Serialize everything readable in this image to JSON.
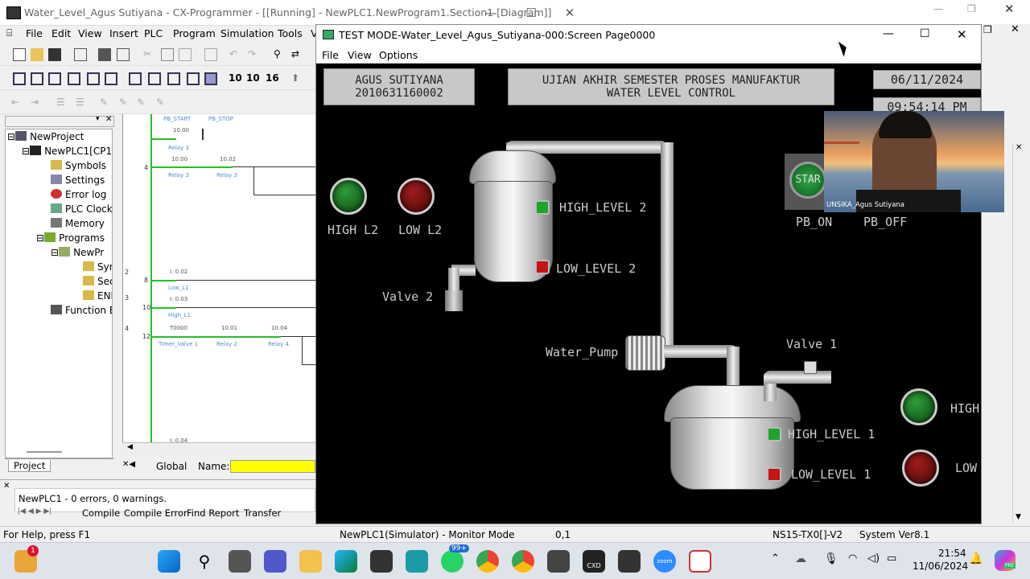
{
  "main_window": {
    "title": "Water_Level_Agus Sutiyana - CX-Programmer - [[Running] - NewPLC1.NewProgram1.Section1 [Diagram]]",
    "menu": [
      "File",
      "Edit",
      "View",
      "Insert",
      "PLC",
      "Program",
      "Simulation",
      "Tools",
      "V"
    ]
  },
  "project_tree": {
    "items": [
      "NewProject",
      "NewPLC1[CP1",
      "Symbols",
      "Settings",
      "Error log",
      "PLC Clock",
      "Memory",
      "Programs",
      "NewPr",
      "Syn",
      "Sec",
      "ENI",
      "Function B"
    ],
    "tab": "Project"
  },
  "ladder": {
    "labels": {
      "pb_start": "PB_START",
      "pb_stop": "PB_STOP",
      "a1": "10.00",
      "relay3a": "Relay 3",
      "a2": "10.00",
      "a3": "10.02",
      "relay3b": "Relay 3",
      "relay3c": "Relay 3",
      "b1": "I: 0.02",
      "low": "Low_L1",
      "c1": "I: 0.03",
      "high": "High_L1",
      "d1": "T0000",
      "d2": "10.01",
      "d3": "10.04",
      "timer": "Timer_Valve 1",
      "relay2": "Relay 2",
      "relay4": "Relay 4",
      "e1": "I: 0.04"
    },
    "rungs": [
      "4",
      "8",
      "10",
      "12"
    ],
    "side_nums": [
      "2",
      "3",
      "4"
    ],
    "global": "Global",
    "name_label": "Name:"
  },
  "output": {
    "message": "NewPLC1 - 0 errors, 0 warnings.",
    "tabs": [
      "Compile",
      "Compile Error",
      "Find Report",
      "Transfer"
    ]
  },
  "statusbar": {
    "help": "For Help, press F1",
    "mode": "NewPLC1(Simulator) - Monitor Mode",
    "pos": "0,1",
    "ns": "NS15-TX0[]-V2",
    "sysver": "System Ver8.1"
  },
  "hmi_window": {
    "title": "TEST MODE-Water_Level_Agus_Sutiyana-000:Screen Page0000",
    "menu": [
      "File",
      "View",
      "Options"
    ]
  },
  "hmi": {
    "name": "AGUS SUTIYANA",
    "nim": "2010631160002",
    "header1": "UJIAN AKHIR SEMESTER PROSES MANUFAKTUR",
    "header2": "WATER LEVEL CONTROL",
    "date": "06/11/2024",
    "time": "09:54:14 PM",
    "high_l2": "HIGH L2",
    "low_l2": "LOW L2",
    "high_level_2": "HIGH_LEVEL 2",
    "low_level_2": "LOW_LEVEL 2",
    "valve2": "Valve 2",
    "water_pump": "Water_Pump",
    "valve1": "Valve 1",
    "high_level_1": "HIGH_LEVEL 1",
    "low_level_1": "LOW_LEVEL 1",
    "high": "HIGH",
    "low": "LOW",
    "start_btn": "STAR",
    "pb_on": "PB_ON",
    "pb_off": "PB_OFF"
  },
  "webcam": {
    "caption": "UNSIKA_Agus Sutiyana"
  },
  "taskbar": {
    "badge_first": "1",
    "badge_chat": "99+",
    "cxd": "CXD",
    "zoom": "zoom",
    "time": "21:54",
    "date": "11/06/2024",
    "copilot": "PRE"
  }
}
